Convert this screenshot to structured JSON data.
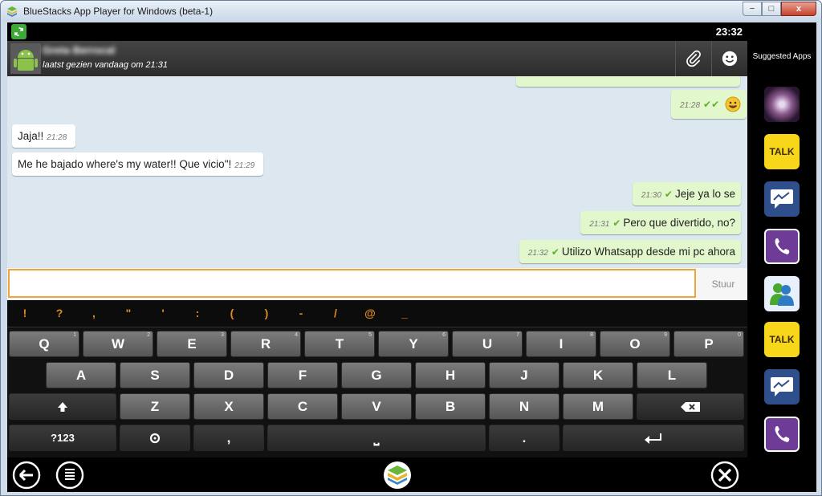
{
  "window": {
    "title": "BlueStacks App Player for Windows (beta-1)",
    "min": "−",
    "max": "□",
    "close": "x"
  },
  "status": {
    "clock": "23:32"
  },
  "header": {
    "contact_name": "Greta Berrocal",
    "last_seen": "laatst gezien vandaag om 21:31"
  },
  "messages": [
    {
      "dir": "out",
      "text": "",
      "time": "21:28",
      "emoji": "smiley"
    },
    {
      "dir": "in",
      "text": "Jaja!!",
      "time": "21:28"
    },
    {
      "dir": "in",
      "text": "Me he bajado where's my water!! Que vicio\"!",
      "time": "21:29"
    },
    {
      "dir": "out",
      "text": "Jeje ya lo se",
      "time": "21:30"
    },
    {
      "dir": "out",
      "text": "Pero que divertido, no?",
      "time": "21:31"
    },
    {
      "dir": "out",
      "text": "Utilizo Whatsapp desde mi pc ahora",
      "time": "21:32"
    }
  ],
  "input": {
    "value": "",
    "send_label": "Stuur"
  },
  "keyboard": {
    "symbols": [
      "!",
      "?",
      ",",
      "\"",
      "'",
      ":",
      "(",
      ")",
      "-",
      "/",
      "@",
      "_"
    ],
    "row1": [
      [
        "Q",
        "1"
      ],
      [
        "W",
        "2"
      ],
      [
        "E",
        "3"
      ],
      [
        "R",
        "4"
      ],
      [
        "T",
        "5"
      ],
      [
        "Y",
        "6"
      ],
      [
        "U",
        "7"
      ],
      [
        "I",
        "8"
      ],
      [
        "O",
        "9"
      ],
      [
        "P",
        "0"
      ]
    ],
    "row2": [
      "A",
      "S",
      "D",
      "F",
      "G",
      "H",
      "J",
      "K",
      "L"
    ],
    "row3": [
      "Z",
      "X",
      "C",
      "V",
      "B",
      "N",
      "M"
    ],
    "mode_label": "?123",
    "comma": ",",
    "period": ".",
    "space": "⎵"
  },
  "sidebar": {
    "title": "Suggested Apps",
    "apps": [
      "galaxy-app",
      "kakaotalk",
      "messenger",
      "viber",
      "msn-messenger",
      "kakaotalk",
      "messenger",
      "viber"
    ]
  },
  "colors": {
    "accent_orange": "#f0a43a",
    "out_bubble": "#e2f7cb",
    "chat_bg": "#dde7ef"
  }
}
